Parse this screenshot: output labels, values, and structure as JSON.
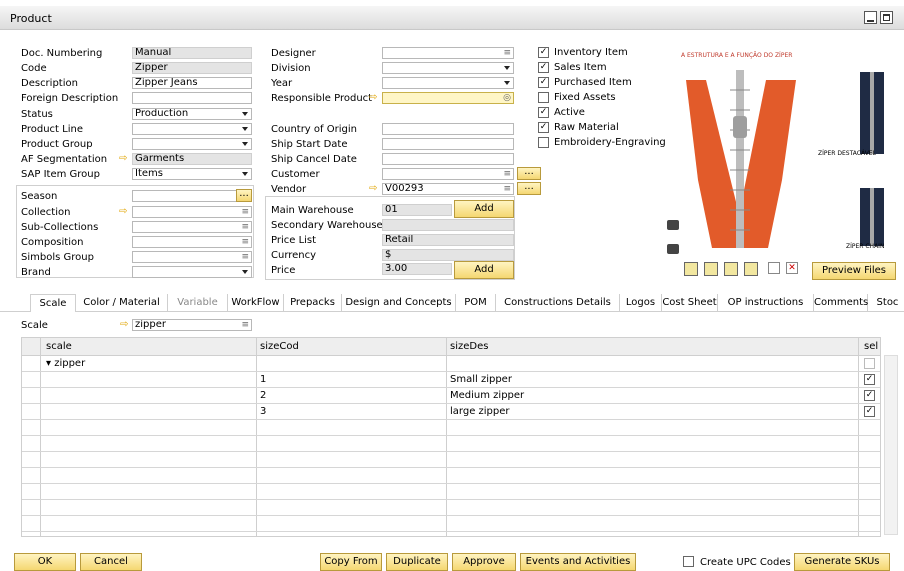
{
  "window": {
    "title": "Product"
  },
  "left_fields": [
    {
      "label": "Doc. Numbering",
      "value": "Manual",
      "kind": "ro"
    },
    {
      "label": "Code",
      "value": "Zipper",
      "kind": "ro"
    },
    {
      "label": "Description",
      "value": "Zipper Jeans",
      "kind": "txt"
    },
    {
      "label": "Foreign Description",
      "value": "",
      "kind": "txt"
    },
    {
      "label": "Status",
      "value": "Production",
      "kind": "dd"
    },
    {
      "label": "Product Line",
      "value": "",
      "kind": "dd"
    },
    {
      "label": "Product Group",
      "value": "",
      "kind": "dd"
    },
    {
      "label": "AF Segmentation",
      "value": "Garments",
      "kind": "ro"
    },
    {
      "label": "SAP Item Group",
      "value": "Items",
      "kind": "dd"
    }
  ],
  "season_fields": [
    {
      "label": "Season",
      "value": "",
      "kind": "dd"
    },
    {
      "label": "Collection",
      "value": "",
      "kind": "ln"
    },
    {
      "label": "Sub-Collections",
      "value": "",
      "kind": "ln"
    },
    {
      "label": "Composition",
      "value": "",
      "kind": "ln"
    },
    {
      "label": "Simbols Group",
      "value": "",
      "kind": "ln"
    },
    {
      "label": "Brand",
      "value": "",
      "kind": "dd"
    }
  ],
  "mid_fields": [
    {
      "label": "Designer",
      "value": "",
      "kind": "ln"
    },
    {
      "label": "Division",
      "value": "",
      "kind": "dd"
    },
    {
      "label": "Year",
      "value": "",
      "kind": "dd"
    },
    {
      "label": "Responsible Product",
      "value": "",
      "kind": "yel"
    },
    {
      "label": "Country of Origin",
      "value": "",
      "kind": "txt"
    },
    {
      "label": "Ship Start Date",
      "value": "",
      "kind": "txt"
    },
    {
      "label": "Ship Cancel Date",
      "value": "",
      "kind": "txt"
    },
    {
      "label": "Customer",
      "value": "",
      "kind": "ln"
    },
    {
      "label": "Vendor",
      "value": "V00293",
      "kind": "ln"
    }
  ],
  "warehouse": {
    "main_label": "Main Warehouse",
    "main_value": "01",
    "secondary_label": "Secondary Warehouses",
    "add": "Add"
  },
  "price": {
    "list_label": "Price List",
    "list_value": "Retail",
    "currency_label": "Currency",
    "currency_value": "$",
    "price_label": "Price",
    "price_value": "3.00",
    "add": "Add"
  },
  "checks": [
    {
      "label": "Inventory Item",
      "checked": true
    },
    {
      "label": "Sales Item",
      "checked": true
    },
    {
      "label": "Purchased Item",
      "checked": true
    },
    {
      "label": "Fixed Assets",
      "checked": false
    },
    {
      "label": "Active",
      "checked": true
    },
    {
      "label": "Raw Material",
      "checked": true
    },
    {
      "label": "Embroidery-Engraving",
      "checked": false
    }
  ],
  "image_panel": {
    "caption_top": "A ESTRUTURA E A FUNÇÃO DO ZÍPER",
    "label_right1": "ZÍPER DESTACÁVEL",
    "label_right2": "ZÍPER CHAIN",
    "preview": "Preview Files"
  },
  "tabs": [
    "Scale",
    "Color / Material",
    "Variable",
    "WorkFlow",
    "Prepacks",
    "Design and Concepts",
    "POM",
    "Constructions Details",
    "Logos",
    "Cost Sheet",
    "OP instructions",
    "Comments",
    "Stoc"
  ],
  "scale_field": {
    "label": "Scale",
    "value": "zipper"
  },
  "grid": {
    "headers": [
      "scale",
      "sizeCod",
      "sizeDes",
      "sel"
    ],
    "group": "zipper",
    "rows": [
      {
        "code": "1",
        "desc": "Small zipper",
        "sel": true
      },
      {
        "code": "2",
        "desc": "Medium zipper",
        "sel": true
      },
      {
        "code": "3",
        "desc": "large zipper",
        "sel": true
      }
    ]
  },
  "footer": {
    "ok": "OK",
    "cancel": "Cancel",
    "copy_from": "Copy From",
    "duplicate": "Duplicate",
    "approve": "Approve",
    "events": "Events and Activities",
    "create_upc": "Create UPC Codes",
    "generate": "Generate SKUs"
  }
}
